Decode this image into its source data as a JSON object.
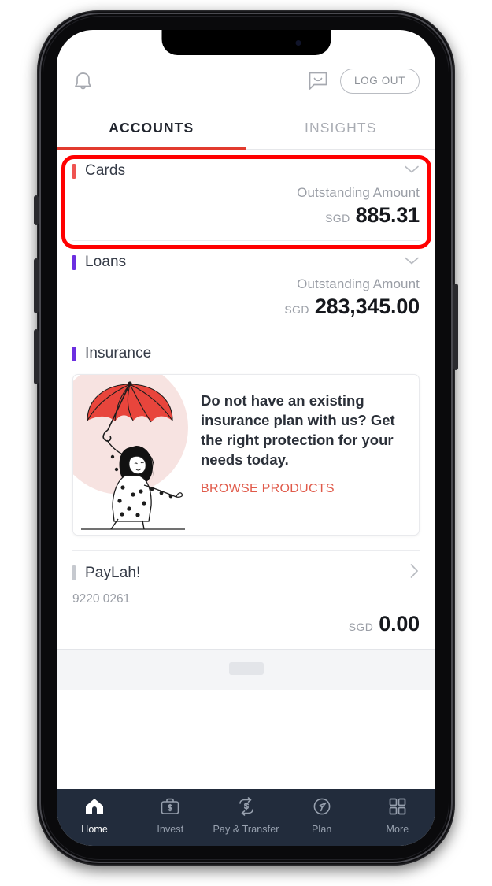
{
  "device": {
    "frame": "smartphone-notch"
  },
  "header": {
    "bell_icon": "bell-icon",
    "chat_icon": "chat-bubble-icon",
    "logout_label": "LOG OUT"
  },
  "tabs": [
    {
      "label": "ACCOUNTS",
      "active": true
    },
    {
      "label": "INSIGHTS",
      "active": false
    }
  ],
  "sections": {
    "cards": {
      "title": "Cards",
      "accent_color": "#ef5350",
      "chevron": "chevron-down-icon",
      "amount_label": "Outstanding Amount",
      "currency": "SGD",
      "amount": "885.31"
    },
    "loans": {
      "title": "Loans",
      "accent_color": "#6c2fe0",
      "chevron": "chevron-down-icon",
      "amount_label": "Outstanding Amount",
      "currency": "SGD",
      "amount": "283,345.00"
    },
    "insurance": {
      "title": "Insurance",
      "accent_color": "#6c2fe0",
      "promo_text": "Do not have an existing insurance plan with us? Get the right protection for your needs today.",
      "cta_label": "BROWSE PRODUCTS",
      "cta_color": "#e05a4a",
      "illustration": "woman-with-red-umbrella-illustration"
    },
    "paylah": {
      "title": "PayLah!",
      "accent_color": "#c6c9cf",
      "chevron": "chevron-right-icon",
      "account_number": "9220 0261",
      "currency": "SGD",
      "amount": "0.00"
    }
  },
  "bottom_nav": [
    {
      "label": "Home",
      "icon": "home-icon",
      "active": true
    },
    {
      "label": "Invest",
      "icon": "briefcase-dollar-icon",
      "active": false
    },
    {
      "label": "Pay & Transfer",
      "icon": "transfer-dollar-icon",
      "active": false
    },
    {
      "label": "Plan",
      "icon": "compass-cursor-icon",
      "active": false
    },
    {
      "label": "More",
      "icon": "grid-icon",
      "active": false
    }
  ],
  "annotation": {
    "shape": "rounded-rectangle-highlight",
    "color": "#ff0000",
    "targets": "cards-section"
  },
  "colors": {
    "nav_bg": "#222c3c",
    "tab_active_underline": "#e23b2e",
    "text_primary": "#21252e",
    "text_muted": "#9a9ea6"
  }
}
